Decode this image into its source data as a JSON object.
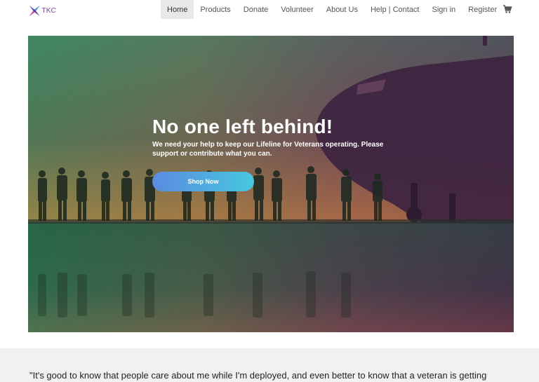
{
  "logo": {
    "text": "TKC",
    "icon": "tkc-star-logo-icon"
  },
  "nav": {
    "items": [
      {
        "label": "Home",
        "active": true
      },
      {
        "label": "Products"
      },
      {
        "label": "Donate"
      },
      {
        "label": "Volunteer"
      },
      {
        "label": "About Us"
      },
      {
        "label": "Help | Contact"
      },
      {
        "label": "Sign in"
      },
      {
        "label": "Register"
      }
    ],
    "cart_icon": "cart-icon"
  },
  "hero": {
    "title": "No one left behind!",
    "subtitle": "We need your help to keep our Lifeline for Veterans operating. Please support or contribute what you can.",
    "button_label": "Shop Now"
  },
  "quote": {
    "text": "\"It's good to know that people care about me while I'm deployed, and even better to know that a veteran is getting"
  },
  "colors": {
    "button_start": "#5b8be0",
    "button_end": "#46c8e0",
    "nav_active_bg": "#e8e8e8",
    "band_bg": "#f1f1f1"
  }
}
